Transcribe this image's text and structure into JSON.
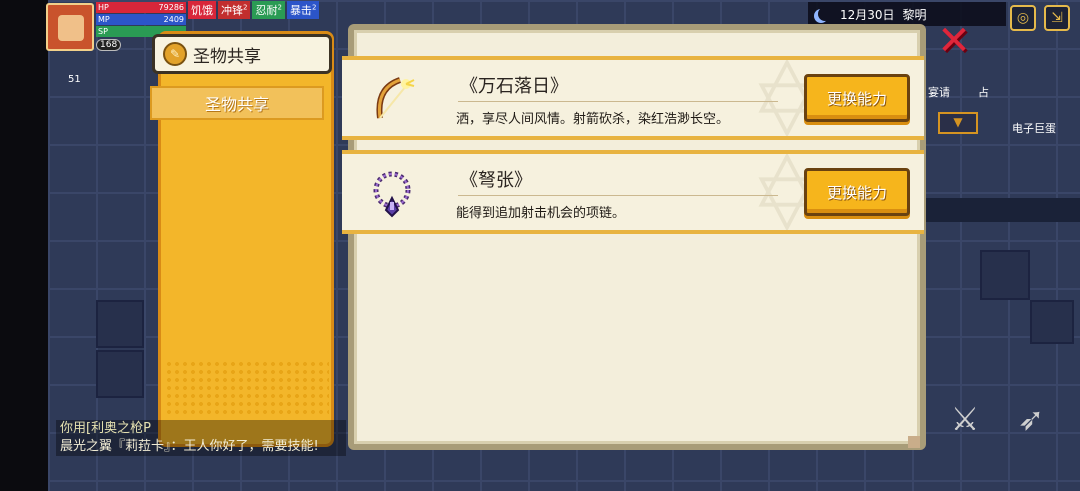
{
  "hud": {
    "hp_label": "HP",
    "mp_label": "MP",
    "sp_label": "SP",
    "hp_value": "79286",
    "mp_value": "2409",
    "level": "168",
    "statuses": [
      {
        "label": "饥饿",
        "color": "#d8263a",
        "stack": ""
      },
      {
        "label": "冲锋",
        "color": "#c22e2e",
        "stack": "2"
      },
      {
        "label": "忍耐",
        "color": "#2a9b54",
        "stack": "2"
      },
      {
        "label": "暴击",
        "color": "#2c55c9",
        "stack": "2"
      }
    ],
    "date": "12月30日",
    "time_of_day": "黎明",
    "left_counter": "51"
  },
  "side_labels": {
    "banquet": "宴请",
    "fortune": "占",
    "egg": "电子巨蛋"
  },
  "tabs": {
    "header_label": "圣物共享",
    "selected_label": "圣物共享"
  },
  "rows": [
    {
      "name": "《万石落日》",
      "description": "洒，享尽人间风情。射箭砍杀，染红浩渺长空。",
      "button": "更换能力",
      "icon": "bow-icon"
    },
    {
      "name": "《弩张》",
      "description": "能得到追加射击机会的项链。",
      "button": "更换能力",
      "icon": "necklace-icon"
    }
  ],
  "chat": {
    "line1": "你用[利奥之枪P",
    "line2": "晨光之翼『莉菈卡』：王人你好了，需要技能!"
  },
  "colors": {
    "panel": "#f3eedb",
    "tab_column": "#f3b62a",
    "button": "#f6b51c",
    "close": "#e0263b"
  }
}
